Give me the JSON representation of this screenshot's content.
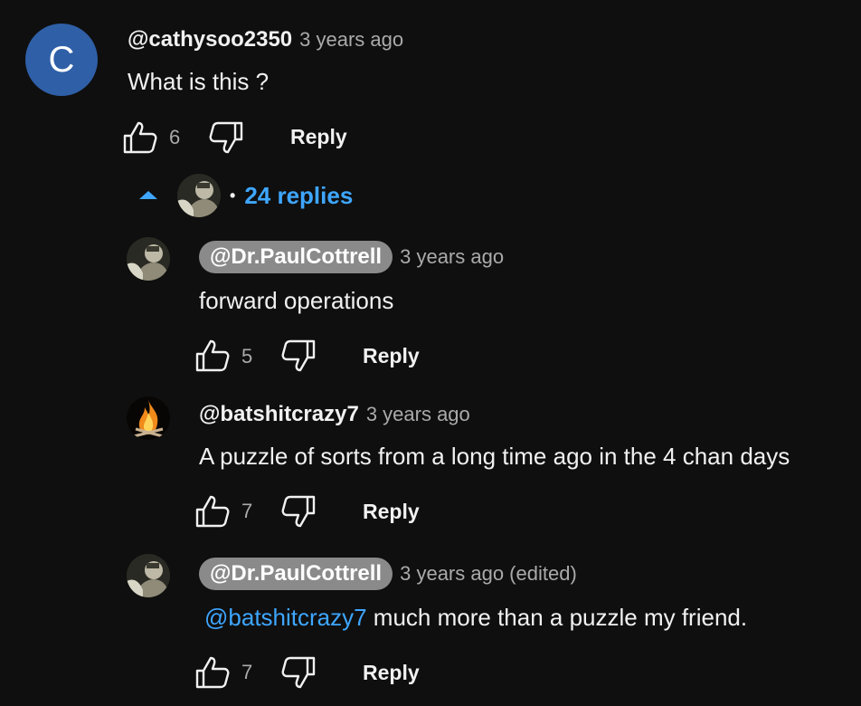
{
  "comment": {
    "avatar_letter": "C",
    "author": "@cathysoo2350",
    "time": "3 years ago",
    "text": "What is this ?",
    "likes": "6",
    "reply_label": "Reply"
  },
  "replies_toggle": {
    "bullet": "•",
    "label": "24 replies"
  },
  "replies": [
    {
      "author": "@Dr.PaulCottrell",
      "time": "3 years ago",
      "text": "forward operations",
      "likes": "5",
      "reply_label": "Reply"
    },
    {
      "author": "@batshitcrazy7",
      "time": "3 years ago",
      "text": "A puzzle of sorts from a long time ago in the 4 chan days",
      "likes": "7",
      "reply_label": "Reply"
    },
    {
      "author": "@Dr.PaulCottrell",
      "time": "3 years ago (edited)",
      "mention": "@batshitcrazy7",
      "text": " much more than a puzzle my friend.",
      "likes": "7",
      "reply_label": "Reply"
    }
  ],
  "colors": {
    "background": "#0f0f0f",
    "link": "#3ea6ff",
    "avatar_c": "#2f5fa7",
    "author_pill": "#8a8a8a"
  },
  "icons": [
    "thumbs-up-icon",
    "thumbs-down-icon",
    "caret-up-icon",
    "fire-avatar",
    "profile-photo-avatar"
  ]
}
